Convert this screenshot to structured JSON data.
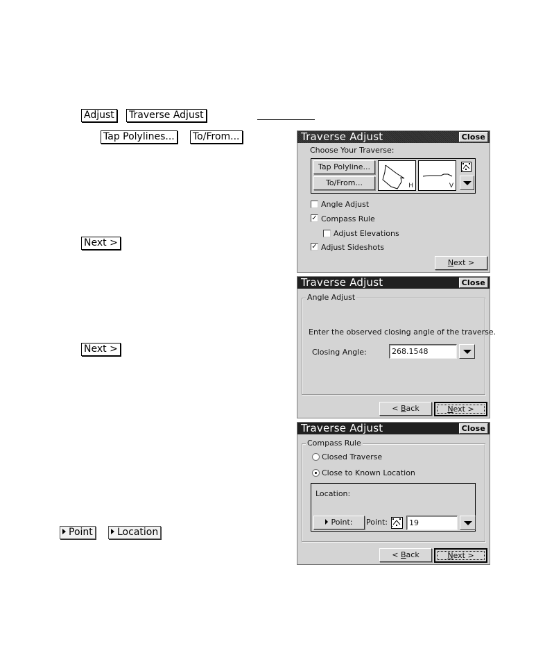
{
  "document": {
    "inline_buttons": {
      "adjust": "Adjust",
      "traverse_adjust": "Traverse Adjust",
      "tap_polylines": "Tap Polylines...",
      "to_from": "To/From...",
      "next_1": "Next >",
      "next_2": "Next >",
      "point": "Point",
      "location": "Location"
    }
  },
  "dialog1": {
    "title": "Traverse Adjust",
    "close_label": "Close",
    "choose_label": "Choose Your Traverse:",
    "tap_polyline_label": "Tap Polyline...",
    "to_from_label": "To/From...",
    "preview_h_tag": "H",
    "preview_v_tag": "V",
    "checkboxes": [
      {
        "label": "Angle Adjust",
        "checked": false
      },
      {
        "label": "Compass Rule",
        "checked": true
      },
      {
        "label": "Adjust Elevations",
        "checked": false
      },
      {
        "label": "Adjust Sideshots",
        "checked": true
      }
    ],
    "check_mark": "✓",
    "next_label_pre": "",
    "next_label_u": "N",
    "next_label_post": "ext >"
  },
  "dialog2": {
    "title": "Traverse Adjust",
    "close_label": "Close",
    "group_label": "Angle Adjust",
    "instruction": "Enter the observed closing angle of the traverse.",
    "closing_angle_label": "Closing Angle:",
    "closing_angle_value": "268.1548",
    "back_pre": "< ",
    "back_u": "B",
    "back_post": "ack",
    "next_u": "N",
    "next_post": "ext >"
  },
  "dialog3": {
    "title": "Traverse Adjust",
    "close_label": "Close",
    "group_label": "Compass Rule",
    "radios": [
      {
        "label": "Closed Traverse",
        "selected": false
      },
      {
        "label": "Close to Known Location",
        "selected": true
      }
    ],
    "location_label": "Location:",
    "point_button_label": "Point:",
    "point_label": "Point:",
    "point_value": "19",
    "back_pre": "< ",
    "back_u": "B",
    "back_post": "ack",
    "next_u": "N",
    "next_post": "ext >"
  }
}
